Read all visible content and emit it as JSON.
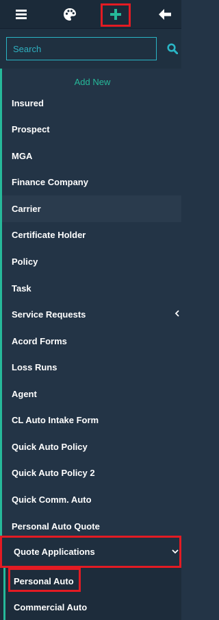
{
  "toolbar": {
    "icons": [
      "menu-icon",
      "palette-icon",
      "plus-icon",
      "arrow-left-icon"
    ]
  },
  "search": {
    "placeholder": "Search",
    "value": "",
    "icon": "search-icon"
  },
  "add_new": {
    "title": "Add New",
    "items": [
      {
        "label": "Insured"
      },
      {
        "label": "Prospect"
      },
      {
        "label": "MGA"
      },
      {
        "label": "Finance Company"
      },
      {
        "label": "Carrier"
      },
      {
        "label": "Certificate Holder"
      },
      {
        "label": "Policy"
      },
      {
        "label": "Task"
      },
      {
        "label": "Service Requests"
      },
      {
        "label": "Acord Forms"
      },
      {
        "label": "Loss Runs"
      },
      {
        "label": "Agent"
      },
      {
        "label": "CL Auto Intake Form"
      },
      {
        "label": "Quick Auto Policy"
      },
      {
        "label": "Quick Auto Policy 2"
      },
      {
        "label": "Quick Comm. Auto"
      },
      {
        "label": "Personal Auto Quote"
      }
    ]
  },
  "quote_applications": {
    "label": "Quote Applications",
    "expanded": true,
    "items": [
      {
        "label": "Personal Auto"
      },
      {
        "label": "Commercial Auto"
      }
    ]
  },
  "colors": {
    "accent": "#26b99a",
    "highlight": "#e31b23",
    "sidebar_bg": "#233446",
    "search_border": "#2ab6c6"
  }
}
